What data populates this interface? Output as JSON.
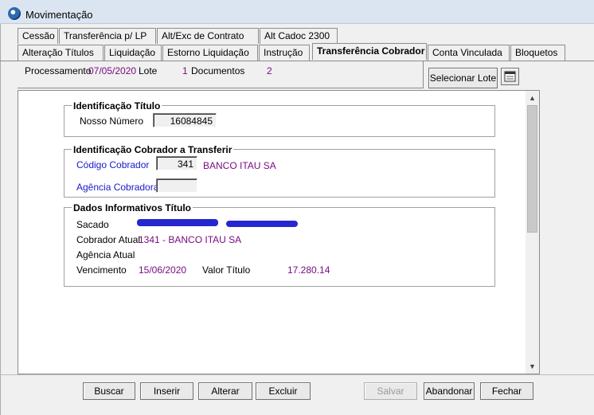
{
  "window": {
    "title": "Movimentação"
  },
  "tabs_row1": [
    "Cessão",
    "Transferência p/ LP",
    "Alt/Exc de Contrato",
    "Alt Cadoc 2300"
  ],
  "tabs_row2": [
    "Alteração Títulos",
    "Liquidação",
    "Estorno Liquidação",
    "Instrução",
    "Transferência Cobrador",
    "Conta Vinculada",
    "Bloquetos"
  ],
  "processing": {
    "label": "Processamento",
    "date": "07/05/2020",
    "lote_label": "Lote",
    "lote_value": "1",
    "docs_label": "Documentos",
    "docs_value": "2",
    "select_button": "Selecionar Lote"
  },
  "identificacao": {
    "title": "Identificação Título",
    "nosso_numero_label": "Nosso Número",
    "nosso_numero_value": "16084845"
  },
  "cobrador": {
    "title": "Identificação Cobrador a Transferir",
    "codigo_label": "Código Cobrador",
    "codigo_value": "341",
    "banco_name": "BANCO ITAU SA",
    "agencia_label": "Agência Cobradora",
    "agencia_value": ""
  },
  "dados": {
    "title": "Dados Informativos Título",
    "sacado_label": "Sacado",
    "cobrador_atual_label": "Cobrador Atual",
    "cobrador_atual_value": "1341 - BANCO ITAU SA",
    "agencia_atual_label": "Agência Atual",
    "vencimento_label": "Vencimento",
    "vencimento_value": "15/06/2020",
    "valor_label": "Valor Título",
    "valor_value": "17.280.14"
  },
  "buttons": {
    "buscar": "Buscar",
    "inserir": "Inserir",
    "alterar": "Alterar",
    "excluir": "Excluir",
    "salvar": "Salvar",
    "abandonar": "Abandonar",
    "fechar": "Fechar"
  },
  "colors": {
    "accent_text": "#7a0c82",
    "link_text": "#1919c8",
    "redaction": "#2727d0"
  }
}
